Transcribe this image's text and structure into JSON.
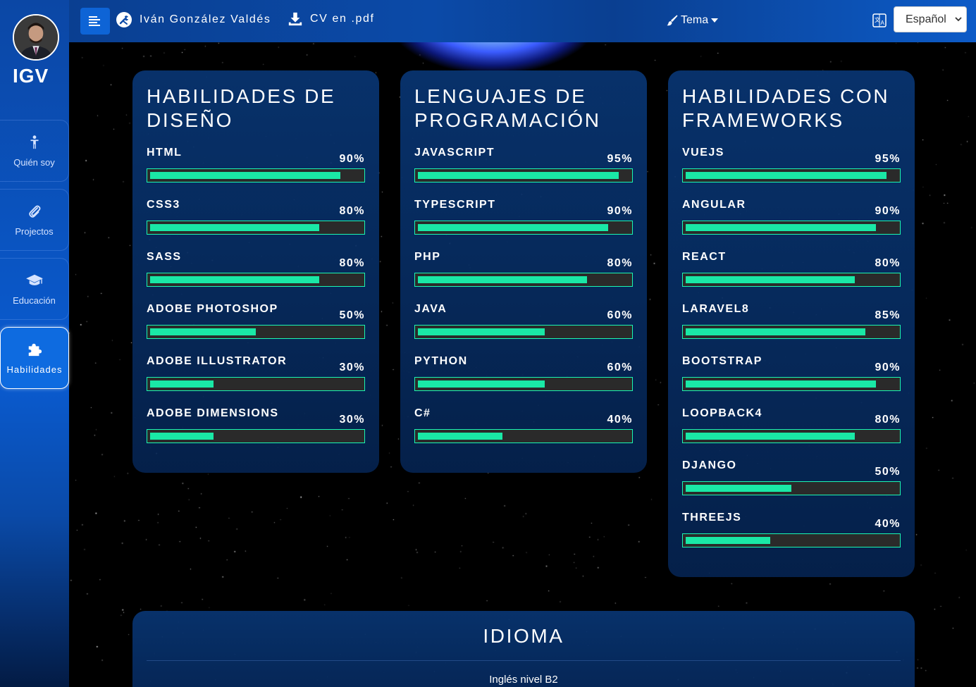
{
  "topbar": {
    "owner_name": "Iván González Valdés",
    "cv_label": "CV en .pdf",
    "theme_label": "Tema",
    "language_selected": "Español"
  },
  "sidebar": {
    "logo": "IGV",
    "items": [
      {
        "label": "Quién soy",
        "icon": "child-icon",
        "active": false
      },
      {
        "label": "Projectos",
        "icon": "paperclip-icon",
        "active": false
      },
      {
        "label": "Educación",
        "icon": "graduation-cap-icon",
        "active": false
      },
      {
        "label": "Habilidades",
        "icon": "puzzle-icon",
        "active": true
      }
    ]
  },
  "cards": [
    {
      "title": "Habilidades de diseño",
      "skills": [
        {
          "name": "HTML",
          "label": "90%",
          "value": 90
        },
        {
          "name": "CSS3",
          "label": "80%",
          "value": 80
        },
        {
          "name": "SASS",
          "label": "80%",
          "value": 80
        },
        {
          "name": "ADOBE PHOTOSHOP",
          "label": "50%",
          "value": 50
        },
        {
          "name": "ADOBE ILLUSTRATOR",
          "label": "30%",
          "value": 30
        },
        {
          "name": "ADOBE DIMENSIONS",
          "label": "30%",
          "value": 30
        }
      ]
    },
    {
      "title": "Lenguajes de programación",
      "skills": [
        {
          "name": "JAVASCRIPT",
          "label": "95%",
          "value": 95
        },
        {
          "name": "TYPESCRIPT",
          "label": "90%",
          "value": 90
        },
        {
          "name": "PHP",
          "label": "80%",
          "value": 80
        },
        {
          "name": "JAVA",
          "label": "60%",
          "value": 60
        },
        {
          "name": "PYTHON",
          "label": "60%",
          "value": 60
        },
        {
          "name": "C#",
          "label": "40%",
          "value": 40
        }
      ]
    },
    {
      "title": "Habilidades con frameworks",
      "skills": [
        {
          "name": "VUEJS",
          "label": "95%",
          "value": 95
        },
        {
          "name": "ANGULAR",
          "label": "90%",
          "value": 90
        },
        {
          "name": "REACT",
          "label": "80%",
          "value": 80
        },
        {
          "name": "LARAVEL8",
          "label": "85%",
          "value": 85
        },
        {
          "name": "BOOTSTRAP",
          "label": "90%",
          "value": 90
        },
        {
          "name": "LOOPBACK4",
          "label": "80%",
          "value": 80
        },
        {
          "name": "DJANGO",
          "label": "50%",
          "value": 50
        },
        {
          "name": "THREEJS",
          "label": "40%",
          "value": 40
        }
      ]
    }
  ],
  "idioma": {
    "title": "IDIOMA",
    "languages": [
      "Inglés nivel B2"
    ]
  },
  "colors": {
    "bar_fill": "#1ae8a6",
    "bar_border": "#1bf7b3",
    "sidebar_blue": "#0a5bd0",
    "card_bg": "#083470"
  }
}
